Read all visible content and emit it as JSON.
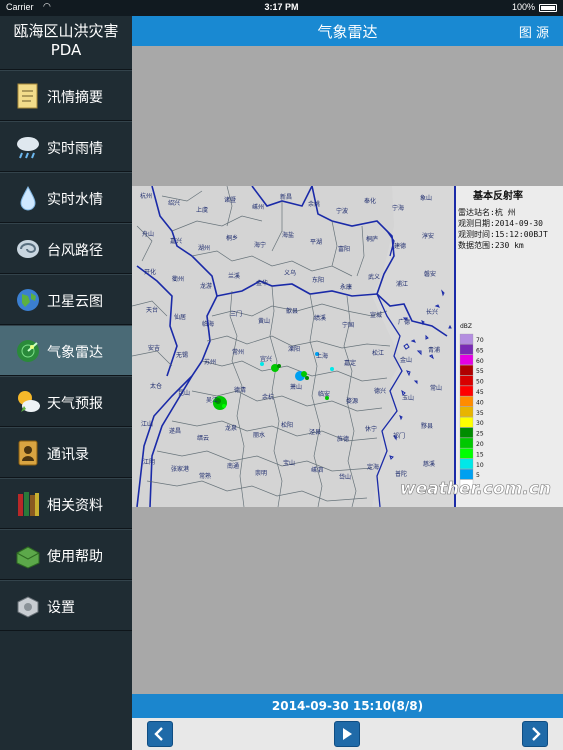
{
  "status_bar": {
    "carrier": "Carrier",
    "time": "3:17 PM",
    "battery": "100%"
  },
  "sidebar": {
    "title": "瓯海区山洪灾害PDA",
    "items": [
      {
        "label": "汛情摘要",
        "icon": "notepad-icon"
      },
      {
        "label": "实时雨情",
        "icon": "rain-cloud-icon"
      },
      {
        "label": "实时水情",
        "icon": "water-drop-icon"
      },
      {
        "label": "台风路径",
        "icon": "typhoon-icon"
      },
      {
        "label": "卫星云图",
        "icon": "globe-icon"
      },
      {
        "label": "气象雷达",
        "icon": "radar-icon",
        "active": true
      },
      {
        "label": "天气预报",
        "icon": "weather-icon"
      },
      {
        "label": "通讯录",
        "icon": "contacts-icon"
      },
      {
        "label": "相关资料",
        "icon": "books-icon"
      },
      {
        "label": "使用帮助",
        "icon": "help-book-icon"
      },
      {
        "label": "设置",
        "icon": "settings-drive-icon"
      }
    ]
  },
  "header": {
    "title": "气象雷达",
    "legend_button": "图 源"
  },
  "radar": {
    "panel_title": "基本反射率",
    "station": "雷达站名:杭 州",
    "obs_date": "观测日期:2014-09-30",
    "obs_time": "观测时间:15:12:00BJT",
    "range": "数据范围:230 km",
    "unit": "dBZ",
    "scale": [
      {
        "value": "70",
        "color": "#b48ee0"
      },
      {
        "value": "65",
        "color": "#7a2bb5"
      },
      {
        "value": "60",
        "color": "#e400e4"
      },
      {
        "value": "55",
        "color": "#b00000"
      },
      {
        "value": "50",
        "color": "#d80000"
      },
      {
        "value": "45",
        "color": "#ff0000"
      },
      {
        "value": "40",
        "color": "#ff8c00"
      },
      {
        "value": "35",
        "color": "#e8b400"
      },
      {
        "value": "30",
        "color": "#ffff00"
      },
      {
        "value": "25",
        "color": "#008c00"
      },
      {
        "value": "20",
        "color": "#00c800"
      },
      {
        "value": "15",
        "color": "#00ff00"
      },
      {
        "value": "10",
        "color": "#00e8e8"
      },
      {
        "value": "5",
        "color": "#00a0f0"
      },
      {
        "value": "",
        "color": "#ffffff"
      }
    ],
    "watermark": "weather.com.cn",
    "cities": [
      "杭州",
      "绍兴",
      "上虞",
      "诸暨",
      "嵊州",
      "新昌",
      "余姚",
      "宁波",
      "奉化",
      "宁海",
      "象山",
      "舟山",
      "嘉兴",
      "湖州",
      "桐乡",
      "海宁",
      "海盐",
      "平湖",
      "富阳",
      "桐庐",
      "建德",
      "淳安",
      "开化",
      "衢州",
      "龙游",
      "兰溪",
      "金华",
      "义乌",
      "东阳",
      "永康",
      "武义",
      "浦江",
      "磐安",
      "天台",
      "仙居",
      "临海",
      "三门",
      "黄山",
      "歙县",
      "绩溪",
      "宁国",
      "宣城",
      "广德",
      "长兴",
      "安吉",
      "无锡",
      "苏州",
      "常州",
      "宜兴",
      "溧阳",
      "上海",
      "嘉定",
      "松江",
      "金山",
      "青浦",
      "太仓",
      "昆山",
      "吴江",
      "德清",
      "余杭",
      "萧山",
      "临安",
      "婺源",
      "德兴",
      "玉山",
      "常山",
      "江山",
      "遂昌",
      "缙云",
      "龙泉",
      "丽水",
      "松阳",
      "泾县",
      "旌德",
      "休宁",
      "祁门",
      "黟县",
      "江阴",
      "张家港",
      "常熟",
      "南通",
      "崇明",
      "宝山",
      "嵊泗",
      "岱山",
      "定海",
      "普陀",
      "慈溪",
      "镇海",
      "北仑",
      "鄞州"
    ]
  },
  "footer": {
    "datetime": "2014-09-30 15:10(8/8)"
  },
  "toolbar": {
    "prev": "previous",
    "play": "play",
    "next": "next"
  }
}
